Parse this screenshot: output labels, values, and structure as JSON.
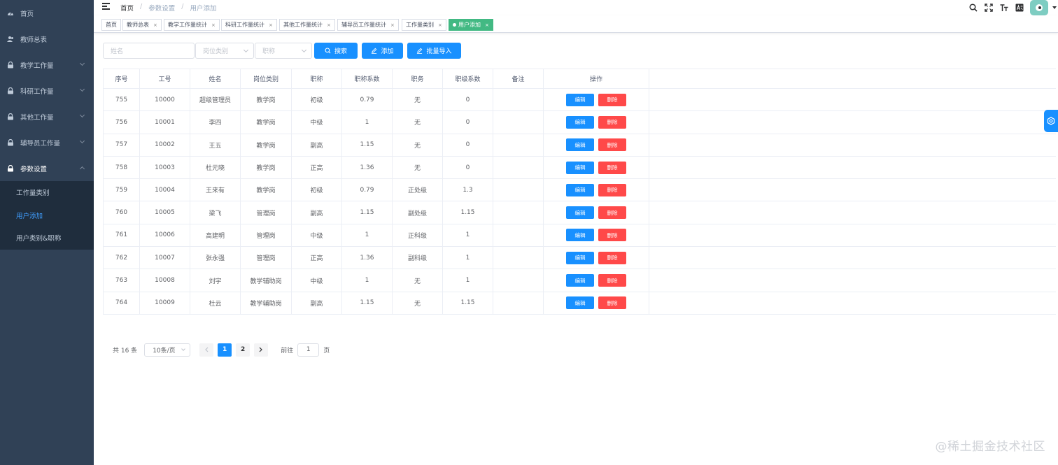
{
  "sidebar": {
    "items": [
      {
        "label": "首页",
        "icon": "dashboard-icon"
      },
      {
        "label": "教师总表",
        "icon": "peoples-icon"
      },
      {
        "label": "教学工作量",
        "icon": "lock-icon",
        "expandable": true
      },
      {
        "label": "科研工作量",
        "icon": "lock-icon",
        "expandable": true
      },
      {
        "label": "其他工作量",
        "icon": "lock-icon",
        "expandable": true
      },
      {
        "label": "辅导员工作量",
        "icon": "lock-icon",
        "expandable": true
      },
      {
        "label": "参数设置",
        "icon": "lock-icon",
        "expandable": true,
        "expanded": true
      }
    ],
    "submenu": [
      {
        "label": "工作量类别"
      },
      {
        "label": "用户添加",
        "active": true
      },
      {
        "label": "用户类别&职称"
      }
    ]
  },
  "navbar": {
    "breadcrumb": [
      "首页",
      "参数设置",
      "用户添加"
    ]
  },
  "tags": [
    {
      "label": "首页"
    },
    {
      "label": "教师总表"
    },
    {
      "label": "教学工作量统计"
    },
    {
      "label": "科研工作量统计"
    },
    {
      "label": "其他工作量统计"
    },
    {
      "label": "辅导员工作量统计"
    },
    {
      "label": "工作量类别"
    },
    {
      "label": "用户添加",
      "active": true
    }
  ],
  "filters": {
    "name_placeholder": "姓名",
    "category_placeholder": "岗位类别",
    "title_placeholder": "职称",
    "search_label": "搜索",
    "add_label": "添加",
    "import_label": "批量导入"
  },
  "table": {
    "headers": [
      "序号",
      "工号",
      "姓名",
      "岗位类别",
      "职称",
      "职称系数",
      "职务",
      "职级系数",
      "备注",
      "操作"
    ],
    "edit_label": "编辑",
    "delete_label": "删除",
    "rows": [
      [
        "755",
        "10000",
        "超级管理员",
        "教学岗",
        "初级",
        "0.79",
        "无",
        "0",
        ""
      ],
      [
        "756",
        "10001",
        "李四",
        "教学岗",
        "中级",
        "1",
        "无",
        "0",
        ""
      ],
      [
        "757",
        "10002",
        "王五",
        "教学岗",
        "副高",
        "1.15",
        "无",
        "0",
        ""
      ],
      [
        "758",
        "10003",
        "杜元晓",
        "教学岗",
        "正高",
        "1.36",
        "无",
        "0",
        ""
      ],
      [
        "759",
        "10004",
        "王来有",
        "教学岗",
        "初级",
        "0.79",
        "正处级",
        "1.3",
        ""
      ],
      [
        "760",
        "10005",
        "梁飞",
        "管理岗",
        "副高",
        "1.15",
        "副处级",
        "1.15",
        ""
      ],
      [
        "761",
        "10006",
        "高建明",
        "管理岗",
        "中级",
        "1",
        "正科级",
        "1",
        ""
      ],
      [
        "762",
        "10007",
        "张永强",
        "管理岗",
        "正高",
        "1.36",
        "副科级",
        "1",
        ""
      ],
      [
        "763",
        "10008",
        "刘宇",
        "教学辅助岗",
        "中级",
        "1",
        "无",
        "1",
        ""
      ],
      [
        "764",
        "10009",
        "杜云",
        "教学辅助岗",
        "副高",
        "1.15",
        "无",
        "1.15",
        ""
      ]
    ]
  },
  "pagination": {
    "total_text": "共 16 条",
    "page_size": "10条/页",
    "pages": [
      "1",
      "2"
    ],
    "current_page": "1",
    "goto_label": "前往",
    "goto_value": "1",
    "goto_suffix": "页"
  },
  "watermark": "@稀土掘金技术社区",
  "colors": {
    "sidebar_bg": "#304156",
    "submenu_bg": "#1f2d3d",
    "primary": "#1890ff",
    "danger": "#ff4949",
    "tag_active": "#42b983",
    "active_text": "#409eff"
  }
}
